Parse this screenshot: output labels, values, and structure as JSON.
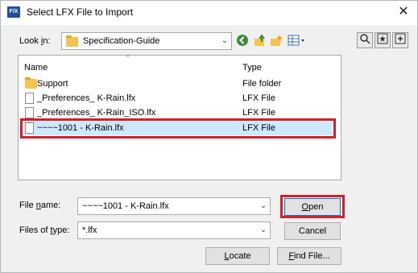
{
  "window": {
    "app_icon_text": "F/X",
    "title": "Select LFX File to Import",
    "close_glyph": "✕"
  },
  "lookin": {
    "label_pre": "Look ",
    "label_key": "i",
    "label_post": "n:",
    "value": "Specification-Guide"
  },
  "list": {
    "col_name": "Name",
    "col_type": "Type",
    "items": [
      {
        "name": "Support",
        "type": "File folder",
        "icon": "folder-icon",
        "selected": false
      },
      {
        "name": "_Preferences_ K-Rain.lfx",
        "type": "LFX File",
        "icon": "file-icon",
        "selected": false
      },
      {
        "name": "_Preferences_ K-Rain_ISO.lfx",
        "type": "LFX File",
        "icon": "file-icon",
        "selected": false
      },
      {
        "name": "~~~~1001 - K-Rain.lfx",
        "type": "LFX File",
        "icon": "file-icon",
        "selected": true
      }
    ]
  },
  "filename": {
    "label_pre": "File ",
    "label_key": "n",
    "label_post": "ame:",
    "value": "~~~~1001 - K-Rain.lfx"
  },
  "filetype": {
    "label_pre": "Files of ",
    "label_key": "t",
    "label_post": "ype:",
    "value": "*.lfx"
  },
  "buttons": {
    "open_key": "O",
    "open_rest": "pen",
    "cancel": "Cancel",
    "locate_key": "L",
    "locate_rest": "ocate",
    "find_key": "F",
    "find_rest": "ind File..."
  },
  "colors": {
    "highlight_red": "#d51e2b",
    "selection_blue": "#cde8ff",
    "folder_yellow": "#f4c453"
  }
}
